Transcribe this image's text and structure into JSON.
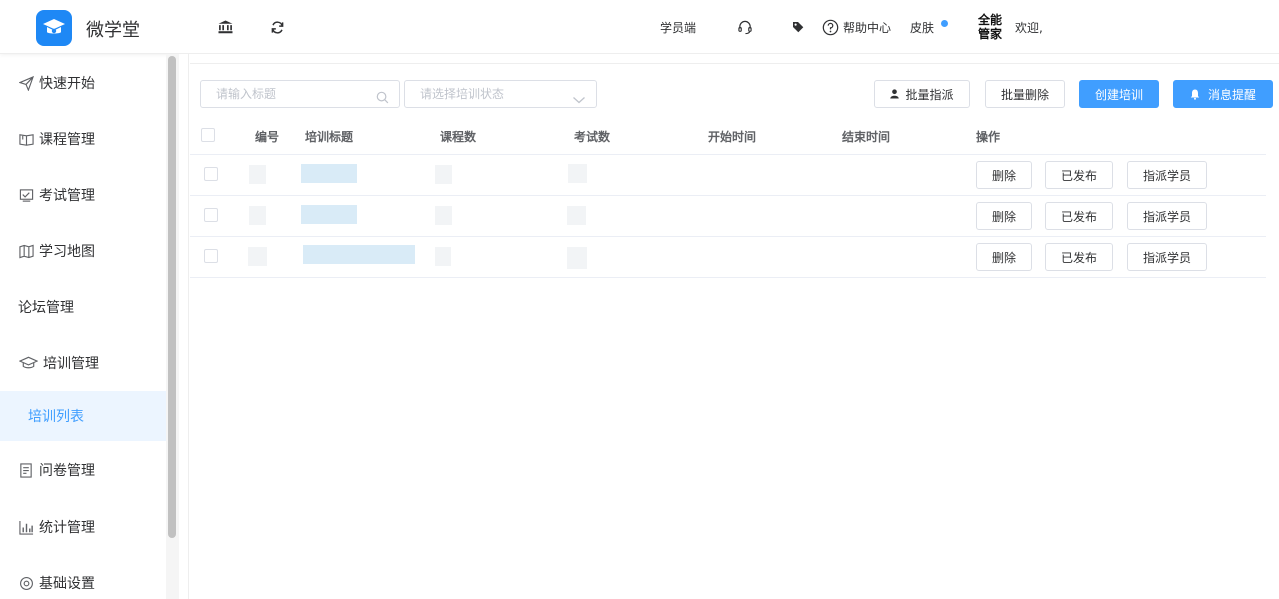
{
  "app": {
    "name": "微学堂"
  },
  "header": {
    "student_link": "学员端",
    "help": "帮助中心",
    "skin": "皮肤",
    "brand": "全能管家",
    "welcome": "欢迎,"
  },
  "sidebar": {
    "items": [
      {
        "label": "快速开始",
        "icon": "send-icon"
      },
      {
        "label": "课程管理",
        "icon": "book-icon"
      },
      {
        "label": "考试管理",
        "icon": "exam-icon"
      },
      {
        "label": "学习地图",
        "icon": "map-icon"
      },
      {
        "label": "论坛管理",
        "icon": ""
      },
      {
        "label": "培训管理",
        "icon": "graduation-cap-icon"
      },
      {
        "label": "培训列表",
        "icon": "",
        "active": true
      },
      {
        "label": "问卷管理",
        "icon": "survey-icon"
      },
      {
        "label": "统计管理",
        "icon": "bar-chart-icon"
      },
      {
        "label": "基础设置",
        "icon": "settings-icon"
      }
    ]
  },
  "toolbar": {
    "title_placeholder": "请输入标题",
    "status_placeholder": "请选择培训状态",
    "batch_assign": "批量指派",
    "batch_delete": "批量删除",
    "create": "创建培训",
    "notify": "消息提醒"
  },
  "table": {
    "columns": [
      "编号",
      "培训标题",
      "课程数",
      "考试数",
      "开始时间",
      "结束时间",
      "操作"
    ],
    "row_actions": {
      "delete": "删除",
      "published": "已发布",
      "assign": "指派学员"
    },
    "row_count": 3
  },
  "colors": {
    "primary": "#409eff",
    "brand_blue": "#1e88f5",
    "active_bg": "#ecf5ff"
  }
}
